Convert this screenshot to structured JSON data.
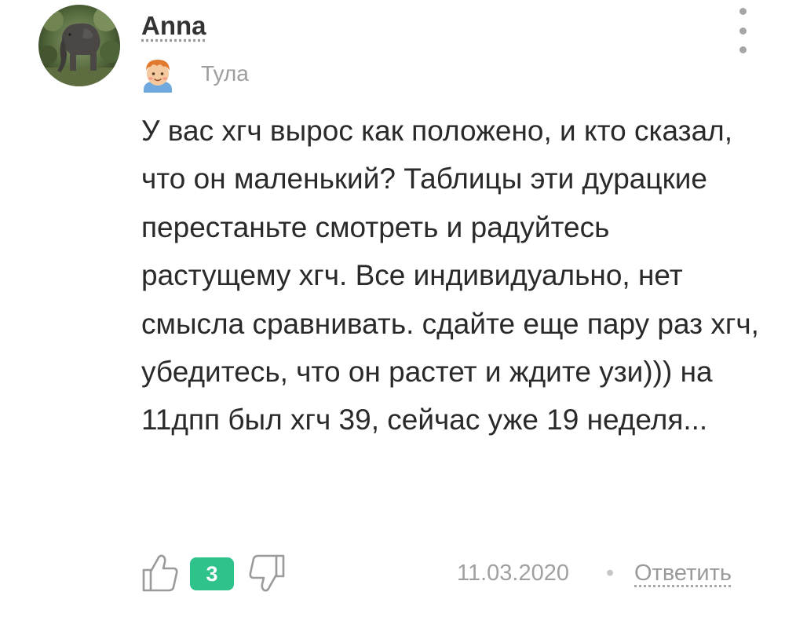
{
  "comment": {
    "author": {
      "name": "Anna",
      "city": "Тула",
      "avatar_icon": "elephant-photo-avatar",
      "badge_icon": "boy-face-badge-icon"
    },
    "text": "У вас хгч вырос как положено, и кто сказал, что он маленький? Таблицы эти дурацкие перестаньте смотреть и радуйтесь растущему хгч. Все индивидуально, нет смысла сравнивать. сдайте еще пару раз хгч, убедитесь, что он растет и ждите узи))) на 11дпп был хгч 39, сейчас уже 19 неделя...",
    "likes": "3",
    "date": "11.03.2020",
    "separator": "•",
    "reply_label": "Ответить",
    "menu_icon": "more-vertical-icon"
  },
  "colors": {
    "accent_green": "#2fc28a",
    "muted_text": "#9e9e9e",
    "main_text": "#2a2a2a"
  }
}
